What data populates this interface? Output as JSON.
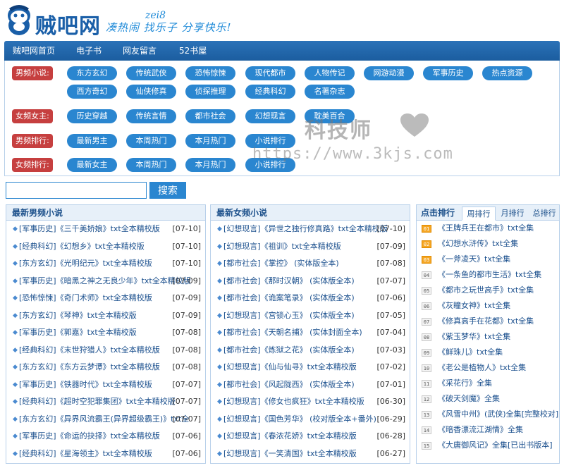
{
  "header": {
    "site_title": "贼吧网",
    "slogan_top": "zei8",
    "slogan": "凑热闹 找乐子 分享快乐!"
  },
  "nav": [
    "贼吧网首页",
    "电子书",
    "网友留言",
    "52书屋"
  ],
  "categories": {
    "male": {
      "label": "男频小说:",
      "items": [
        "东方玄幻",
        "传统武侠",
        "恐怖惊悚",
        "现代都市",
        "人物传记",
        "网游动漫",
        "军事历史",
        "热点资源",
        "西方奇幻",
        "仙侠修真",
        "侦探推理",
        "经典科幻",
        "名著杂志"
      ]
    },
    "female": {
      "label": "女频女主:",
      "items": [
        "历史穿越",
        "传统言情",
        "都市社会",
        "幻想现言",
        "耽美百合"
      ]
    },
    "male_rank": {
      "label": "男频排行:",
      "items": [
        "最新男主",
        "本周热门",
        "本月热门",
        "小说排行"
      ]
    },
    "female_rank": {
      "label": "女频排行:",
      "items": [
        "最新女主",
        "本周热门",
        "本月热门",
        "小说排行"
      ]
    }
  },
  "watermark": {
    "text": "科技师",
    "url": "https://www.3kjs.com"
  },
  "search": {
    "value": "",
    "button": "搜索"
  },
  "male_new": {
    "title": "最新男频小说",
    "rows": [
      {
        "title": "[军事历史]《三千美娇娘》txt全本精校版",
        "date": "[07-10]"
      },
      {
        "title": "[经典科幻]《幻想乡》txt全本精校版",
        "date": "[07-10]"
      },
      {
        "title": "[东方玄幻]《光明纪元》txt全本精校版",
        "date": "[07-10]"
      },
      {
        "title": "[军事历史]《暗黑之神之无良少年》txt全本精校版",
        "date": "[07-09]"
      },
      {
        "title": "[恐怖惊悚]《奇门术师》txt全本精校版",
        "date": "[07-09]"
      },
      {
        "title": "[东方玄幻]《琴神》txt全本精校版",
        "date": "[07-09]"
      },
      {
        "title": "[军事历史]《郭嘉》txt全本精校版",
        "date": "[07-08]"
      },
      {
        "title": "[经典科幻]《末世狩猎人》txt全本精校版",
        "date": "[07-08]"
      },
      {
        "title": "[东方玄幻]《东方云梦谭》txt全本精校版",
        "date": "[07-08]"
      },
      {
        "title": "[军事历史]《铁器时代》txt全本精校版",
        "date": "[07-07]"
      },
      {
        "title": "[经典科幻]《超时空犯罪集团》txt全本精校版",
        "date": "[07-07]"
      },
      {
        "title": "[东方玄幻]《异界风流霸王(异界超级霸王)》txt全",
        "date": "[07-07]"
      },
      {
        "title": "[军事历史]《命运的抉择》txt全本精校版",
        "date": "[07-06]"
      },
      {
        "title": "[经典科幻]《星海领主》txt全本精校版",
        "date": "[07-06]"
      }
    ]
  },
  "female_new": {
    "title": "最新女频小说",
    "rows": [
      {
        "title": "[幻想现言]《异世之独行修真路》txt全本精校版",
        "date": "[07-10]"
      },
      {
        "title": "[幻想现言]《祖训》txt全本精校版",
        "date": "[07-09]"
      },
      {
        "title": "[都市社会]《掌控》 (实体版全本)",
        "date": "[07-08]"
      },
      {
        "title": "[都市社会]《那时汉朝》 (实体版全本)",
        "date": "[07-07]"
      },
      {
        "title": "[都市社会]《诡案笔录》 (实体版全本)",
        "date": "[07-06]"
      },
      {
        "title": "[幻想现言]《宫锁心玉》 (实体版全本)",
        "date": "[07-05]"
      },
      {
        "title": "[都市社会]《天朝名捕》 (实体封面全本)",
        "date": "[07-04]"
      },
      {
        "title": "[都市社会]《炼狱之花》 (实体版全本)",
        "date": "[07-03]"
      },
      {
        "title": "[幻想现言]《仙与仙寻》txt全本精校版",
        "date": "[07-02]"
      },
      {
        "title": "[都市社会]《风起陇西》 (实体版全本)",
        "date": "[07-01]"
      },
      {
        "title": "[幻想现言]《修女也疯狂》txt全本精校版",
        "date": "[06-30]"
      },
      {
        "title": "[幻想现言]《国色芳华》 (校对版全本+番外)",
        "date": "[06-29]"
      },
      {
        "title": "[幻想现言]《春浓花娇》txt全本精校版",
        "date": "[06-28]"
      },
      {
        "title": "[幻想现言]《一笑清国》txt全本精校版",
        "date": "[06-27]"
      }
    ]
  },
  "ranking": {
    "title": "点击排行",
    "tabs": [
      "周排行",
      "月排行",
      "总排行"
    ],
    "active_tab": 0,
    "items": [
      {
        "num": "01",
        "title": "《王牌兵王在都市》txt全集"
      },
      {
        "num": "02",
        "title": "《幻想水浒传》txt全集"
      },
      {
        "num": "03",
        "title": "《一斧凌天》txt全集"
      },
      {
        "num": "04",
        "title": "《一条鱼的都市生活》txt全集"
      },
      {
        "num": "05",
        "title": "《都市之玩世高手》txt全集"
      },
      {
        "num": "06",
        "title": "《灰瞳女神》txt全集"
      },
      {
        "num": "07",
        "title": "《修真高手在花都》txt全集"
      },
      {
        "num": "08",
        "title": "《紫玉梦华》txt全集"
      },
      {
        "num": "09",
        "title": "《鲜珠儿》txt全集"
      },
      {
        "num": "10",
        "title": "《老公是植物人》txt全集"
      },
      {
        "num": "11",
        "title": "《采花行》全集"
      },
      {
        "num": "12",
        "title": "《破天剑魔》全集"
      },
      {
        "num": "13",
        "title": "《风雪中州》(武侠)全集[完整校对]"
      },
      {
        "num": "14",
        "title": "《暗香漂流江湖情》全集"
      },
      {
        "num": "15",
        "title": "《大唐御风记》全集[已出书版本]"
      }
    ]
  },
  "colors": {
    "nav_bg": "#1b5d9f",
    "cat_label": "#c63f3f",
    "cat_btn": "#2a86d0",
    "panel_head": "#e7f0f9",
    "rank_top": "#f5a623"
  }
}
